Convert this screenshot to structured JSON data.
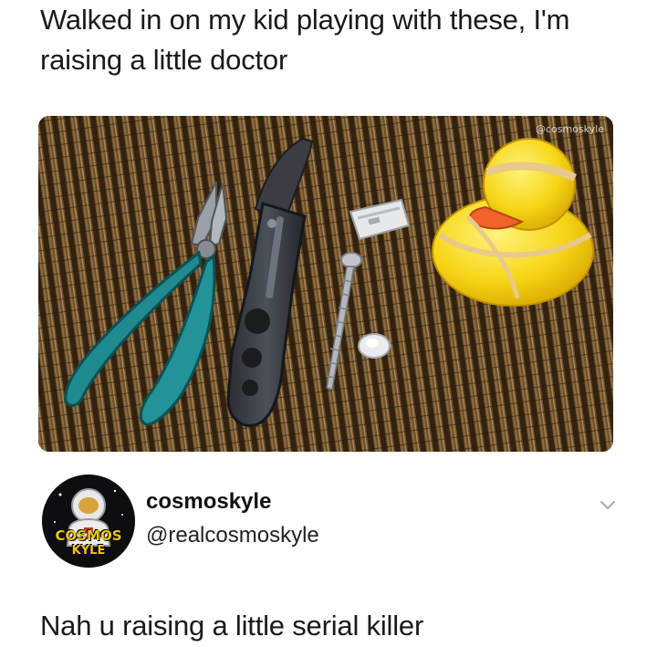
{
  "post": {
    "caption": "Walked in on my kid playing with these, I'm raising a little doctor",
    "photo_watermark": "@cosmoskyle",
    "photo_icon": "photo-of-pliers-knife-razor-screw-rubber-duck"
  },
  "reply": {
    "avatar_icon": "astronaut-avatar-icon",
    "avatar_top_text": "COSMOS",
    "avatar_bottom_text": "KYLE",
    "display_name": "cosmoskyle",
    "handle": "@realcosmoskyle",
    "menu_icon": "chevron-down-icon",
    "text": "Nah u raising a little serial killer"
  },
  "colors": {
    "text": "#1a1a1a",
    "avatar_accent": "#f1c40f"
  }
}
